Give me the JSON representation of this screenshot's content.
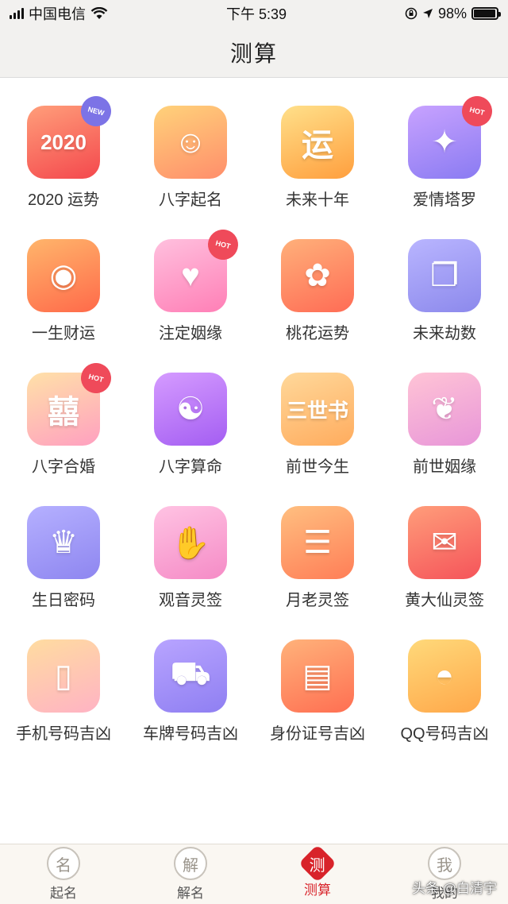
{
  "status_bar": {
    "carrier": "中国电信",
    "time": "下午 5:39",
    "battery": "98%",
    "battery_level": 0.98,
    "icons": [
      "signal-icon",
      "wifi-icon",
      "lock-rotation-icon",
      "location-icon",
      "battery-icon"
    ]
  },
  "nav": {
    "title": "测算"
  },
  "items": [
    {
      "label": "2020 运势",
      "glyph": "2020",
      "icon": "gold-ingot-2020-icon",
      "badge": "NEW",
      "colors": [
        "#ff9e7a",
        "#f4484d"
      ]
    },
    {
      "label": "八字起名",
      "glyph": "☺",
      "icon": "baby-icon",
      "badge": "",
      "colors": [
        "#ffd27a",
        "#ff8e6b"
      ]
    },
    {
      "label": "未来十年",
      "glyph": "运",
      "icon": "yun-character-icon",
      "badge": "",
      "colors": [
        "#ffe08a",
        "#ff9f3e"
      ]
    },
    {
      "label": "爱情塔罗",
      "glyph": "✦",
      "icon": "tarot-card-icon",
      "badge": "HOT",
      "colors": [
        "#c8a2ff",
        "#8a7bf2"
      ]
    },
    {
      "label": "一生财运",
      "glyph": "◉",
      "icon": "gold-ingot-icon",
      "badge": "",
      "colors": [
        "#ffb56b",
        "#ff6a4a"
      ]
    },
    {
      "label": "注定姻缘",
      "glyph": "♥",
      "icon": "hearts-icon",
      "badge": "HOT",
      "colors": [
        "#ffc0de",
        "#ff7fb6"
      ]
    },
    {
      "label": "桃花运势",
      "glyph": "✿",
      "icon": "peach-blossom-icon",
      "badge": "",
      "colors": [
        "#ffb07a",
        "#ff6c55"
      ]
    },
    {
      "label": "未来劫数",
      "glyph": "❐",
      "icon": "open-book-icon",
      "badge": "",
      "colors": [
        "#b9b5ff",
        "#8c89ec"
      ]
    },
    {
      "label": "八字合婚",
      "glyph": "囍",
      "icon": "double-happiness-icon",
      "badge": "HOT",
      "colors": [
        "#ffe1a8",
        "#ffa0c0"
      ]
    },
    {
      "label": "八字算命",
      "glyph": "☯",
      "icon": "bagua-icon",
      "badge": "",
      "colors": [
        "#d59bff",
        "#a45ef2"
      ]
    },
    {
      "label": "前世今生",
      "glyph": "三世书",
      "icon": "scroll-icon",
      "badge": "",
      "colors": [
        "#ffd89a",
        "#ffac5e"
      ]
    },
    {
      "label": "前世姻缘",
      "glyph": "❦",
      "icon": "couple-silhouette-icon",
      "badge": "",
      "colors": [
        "#ffc4d6",
        "#e896d8"
      ]
    },
    {
      "label": "生日密码",
      "glyph": "♛",
      "icon": "crown-icon",
      "badge": "",
      "colors": [
        "#b5b0ff",
        "#8e86f0"
      ]
    },
    {
      "label": "观音灵签",
      "glyph": "✋",
      "icon": "guanyin-hand-icon",
      "badge": "",
      "colors": [
        "#ffc3e3",
        "#f58bc6"
      ]
    },
    {
      "label": "月老灵签",
      "glyph": "☰",
      "icon": "fortune-sticks-icon",
      "badge": "",
      "colors": [
        "#ffbf80",
        "#ff7e57"
      ]
    },
    {
      "label": "黄大仙灵签",
      "glyph": "✉",
      "icon": "charm-tablet-icon",
      "badge": "",
      "colors": [
        "#ff9d7a",
        "#f5545a"
      ]
    },
    {
      "label": "手机号码吉凶",
      "glyph": "▯",
      "icon": "mobile-phone-icon",
      "badge": "",
      "colors": [
        "#ffdca0",
        "#ffb3c4"
      ]
    },
    {
      "label": "车牌号码吉凶",
      "glyph": "⛟",
      "icon": "car-icon",
      "badge": "",
      "colors": [
        "#b8a4ff",
        "#8f7ff2"
      ]
    },
    {
      "label": "身份证号吉凶",
      "glyph": "▤",
      "icon": "id-card-icon",
      "badge": "",
      "colors": [
        "#ffb27a",
        "#ff6f52"
      ]
    },
    {
      "label": "QQ号码吉凶",
      "glyph": "◓",
      "icon": "qq-penguin-icon",
      "badge": "",
      "colors": [
        "#ffd97a",
        "#ffa84a"
      ]
    }
  ],
  "badge_colors": {
    "NEW": "#7c73e6",
    "HOT": "#ef4a5a"
  },
  "tabs": [
    {
      "label": "起名",
      "glyph": "名",
      "icon": "name-seal-icon",
      "active": false
    },
    {
      "label": "解名",
      "glyph": "解",
      "icon": "decode-seal-icon",
      "active": false
    },
    {
      "label": "测算",
      "glyph": "测",
      "icon": "measure-seal-icon",
      "active": true
    },
    {
      "label": "我的",
      "glyph": "我",
      "icon": "me-seal-icon",
      "active": false
    }
  ],
  "watermark": "头条 @白清宇",
  "accent_color": "#d8232a"
}
